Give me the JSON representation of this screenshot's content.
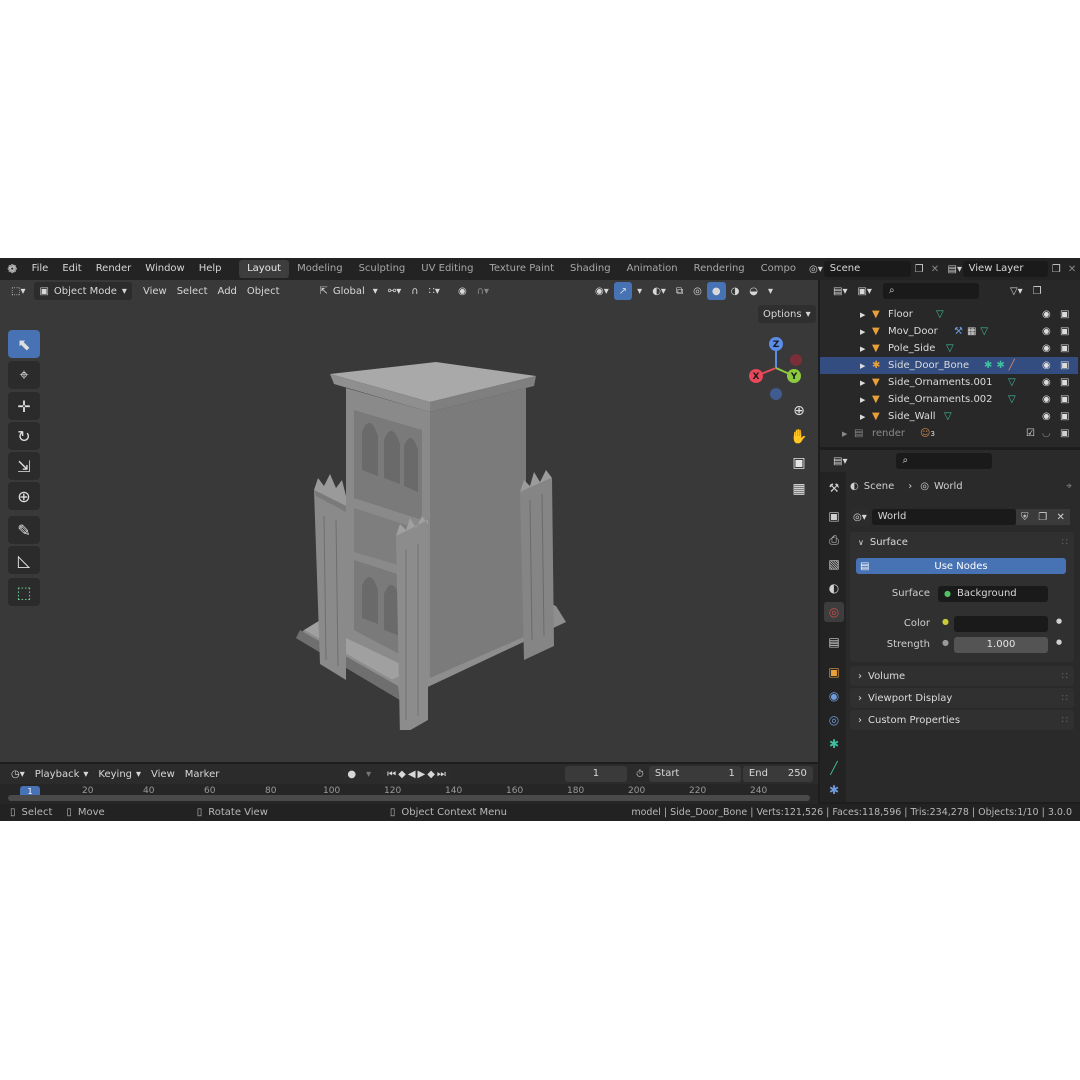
{
  "colors": {
    "accent": "#4772b3",
    "selection": "#334d80",
    "mesh_icon": "#e8a03a",
    "vertex_group": "#3fbfa0",
    "world": "#c9504a"
  },
  "menu": {
    "items": [
      "File",
      "Edit",
      "Render",
      "Window",
      "Help"
    ]
  },
  "workspaces": {
    "tabs": [
      "Layout",
      "Modeling",
      "Sculpting",
      "UV Editing",
      "Texture Paint",
      "Shading",
      "Animation",
      "Rendering",
      "Compo"
    ],
    "active": "Layout"
  },
  "scene": {
    "name": "Scene"
  },
  "view_layer": {
    "name": "View Layer"
  },
  "viewport_header": {
    "mode": "Object Mode",
    "menus": [
      "View",
      "Select",
      "Add",
      "Object"
    ],
    "orientation": "Global",
    "options_label": "Options"
  },
  "gizmo": {
    "z": "Z",
    "y": "Y",
    "x": "X"
  },
  "outliner": {
    "rows": [
      {
        "name": "Floor"
      },
      {
        "name": "Mov_Door"
      },
      {
        "name": "Pole_Side"
      },
      {
        "name": "Side_Door_Bone",
        "selected": true
      },
      {
        "name": "Side_Ornaments.001"
      },
      {
        "name": "Side_Ornaments.002"
      },
      {
        "name": "Side_Wall"
      }
    ],
    "collection": {
      "name": "render",
      "badge": "3"
    }
  },
  "properties": {
    "breadcrumb": {
      "scene": "Scene",
      "world": "World"
    },
    "world_name": "World",
    "surface_panel": {
      "title": "Surface",
      "use_nodes": "Use Nodes",
      "surface_label": "Surface",
      "surface_value": "Background",
      "color_label": "Color",
      "strength_label": "Strength",
      "strength_value": "1.000"
    },
    "collapsed_panels": [
      "Volume",
      "Viewport Display",
      "Custom Properties"
    ]
  },
  "timeline": {
    "menus": [
      "Playback",
      "Keying",
      "View",
      "Marker"
    ],
    "current_frame": "1",
    "start_label": "Start",
    "start_value": "1",
    "end_label": "End",
    "end_value": "250",
    "ruler": [
      "1",
      "20",
      "40",
      "60",
      "80",
      "100",
      "120",
      "140",
      "160",
      "180",
      "200",
      "220",
      "240"
    ]
  },
  "statusbar": {
    "select": "Select",
    "move": "Move",
    "rotate": "Rotate View",
    "context": "Object Context Menu",
    "info": "model | Side_Door_Bone | Verts:121,526 | Faces:118,596 | Tris:234,278 | Objects:1/10 | 3.0.0"
  }
}
